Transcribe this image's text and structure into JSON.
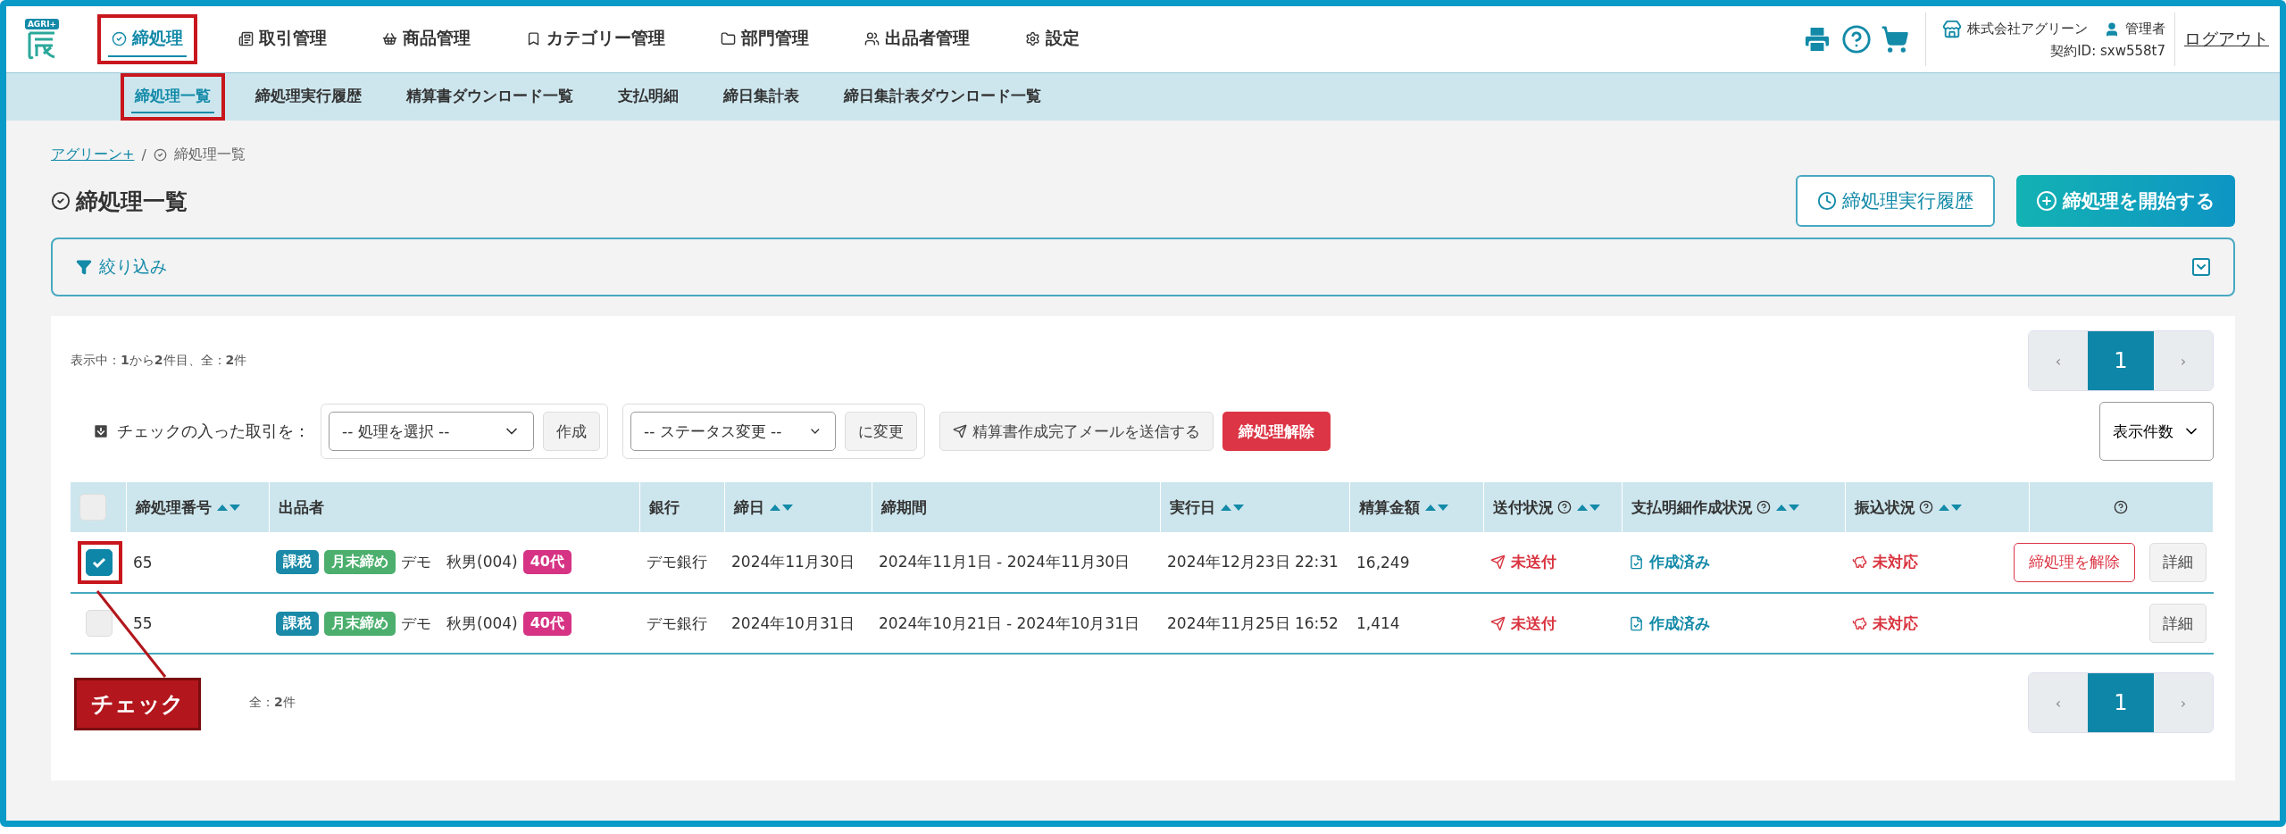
{
  "header": {
    "logo_badge": "AGRI+",
    "nav": [
      {
        "label": "締処理",
        "selected": true,
        "highlighted": true
      },
      {
        "label": "取引管理",
        "selected": false,
        "highlighted": false
      },
      {
        "label": "商品管理",
        "selected": false,
        "highlighted": false
      },
      {
        "label": "カテゴリー管理",
        "selected": false,
        "highlighted": false
      },
      {
        "label": "部門管理",
        "selected": false,
        "highlighted": false
      },
      {
        "label": "出品者管理",
        "selected": false,
        "highlighted": false
      },
      {
        "label": "設定",
        "selected": false,
        "highlighted": false
      }
    ],
    "company": "株式会社アグリーン",
    "user": "管理者",
    "contract": "契約ID: sxw558t7",
    "logout": "ログアウト"
  },
  "subnav": [
    {
      "label": "締処理一覧",
      "selected": true,
      "highlighted": true
    },
    {
      "label": "締処理実行履歴",
      "selected": false,
      "highlighted": false
    },
    {
      "label": "精算書ダウンロード一覧",
      "selected": false,
      "highlighted": false
    },
    {
      "label": "支払明細",
      "selected": false,
      "highlighted": false
    },
    {
      "label": "締日集計表",
      "selected": false,
      "highlighted": false
    },
    {
      "label": "締日集計表ダウンロード一覧",
      "selected": false,
      "highlighted": false
    }
  ],
  "breadcrumb": {
    "link": "アグリーン+",
    "separator": "/",
    "current": "締処理一覧"
  },
  "page_title": "締処理一覧",
  "buttons": {
    "history": "締処理実行履歴",
    "start": "締処理を開始する"
  },
  "filter": {
    "label": "絞り込み"
  },
  "summary_top": "表示中：**1**から**2**件目、全：**2**件",
  "pagination_top": {
    "prev": "‹",
    "pages": [
      {
        "label": "1",
        "selected": true
      }
    ],
    "next": "›"
  },
  "bulk": {
    "label": "チェックの入った取引を：",
    "action_select": "-- 処理を選択 --",
    "create": "作成",
    "status_select": "-- ステータス変更 --",
    "change": "に変更",
    "mail": "精算書作成完了メールを送信する",
    "release": "締処理解除"
  },
  "page_size": "表示件数",
  "table": {
    "all_checked": false,
    "columns": [
      {
        "label": "締処理番号",
        "sortable": true,
        "help": false
      },
      {
        "label": "出品者",
        "sortable": false,
        "help": false
      },
      {
        "label": "銀行",
        "sortable": false,
        "help": false
      },
      {
        "label": "締日",
        "sortable": true,
        "help": false
      },
      {
        "label": "締期間",
        "sortable": false,
        "help": false
      },
      {
        "label": "実行日",
        "sortable": true,
        "help": false
      },
      {
        "label": "精算金額",
        "sortable": true,
        "help": false
      },
      {
        "label": "送付状況",
        "sortable": true,
        "help": true
      },
      {
        "label": "支払明細作成状況",
        "sortable": true,
        "help": true
      },
      {
        "label": "振込状況",
        "sortable": true,
        "help": true
      },
      {
        "sortable": false,
        "help": true
      }
    ],
    "rows": [
      {
        "checked": true,
        "highlighted": true,
        "number": "65",
        "tags": [
          {
            "label": "課税",
            "color": "#1a8aa8"
          },
          {
            "label": "月末締め",
            "color": "#4caf6e"
          }
        ],
        "seller": "デモ　秋男(004)",
        "age": {
          "label": "40代",
          "color": "#d63384"
        },
        "bank": "デモ銀行",
        "close_date": "2024年11月30日",
        "period": "2024年11月1日 - 2024年11月30日",
        "run_date": "2024年12月23日 22:31",
        "amount": "16,249",
        "send": {
          "label": "未送付",
          "color": "#d9343f"
        },
        "statement": {
          "label": "作成済み",
          "color": "#138aa8"
        },
        "transfer": {
          "label": "未対応",
          "color": "#d9343f"
        },
        "release": "締処理を解除",
        "detail": "詳細"
      },
      {
        "checked": false,
        "highlighted": false,
        "number": "55",
        "tags": [
          {
            "label": "課税",
            "color": "#1a8aa8"
          },
          {
            "label": "月末締め",
            "color": "#4caf6e"
          }
        ],
        "seller": "デモ　秋男(004)",
        "age": {
          "label": "40代",
          "color": "#d63384"
        },
        "bank": "デモ銀行",
        "close_date": "2024年10月31日",
        "period": "2024年10月21日 - 2024年10月31日",
        "run_date": "2024年11月25日 16:52",
        "amount": "1,414",
        "send": {
          "label": "未送付",
          "color": "#d9343f"
        },
        "statement": {
          "label": "作成済み",
          "color": "#138aa8"
        },
        "transfer": {
          "label": "未対応",
          "color": "#d9343f"
        },
        "detail": "詳細"
      }
    ]
  },
  "summary_bottom": "全：**2**件",
  "pagination_bottom": {
    "prev": "‹",
    "pages": [
      {
        "label": "1",
        "selected": true
      }
    ],
    "next": "›"
  },
  "callout": "チェック"
}
